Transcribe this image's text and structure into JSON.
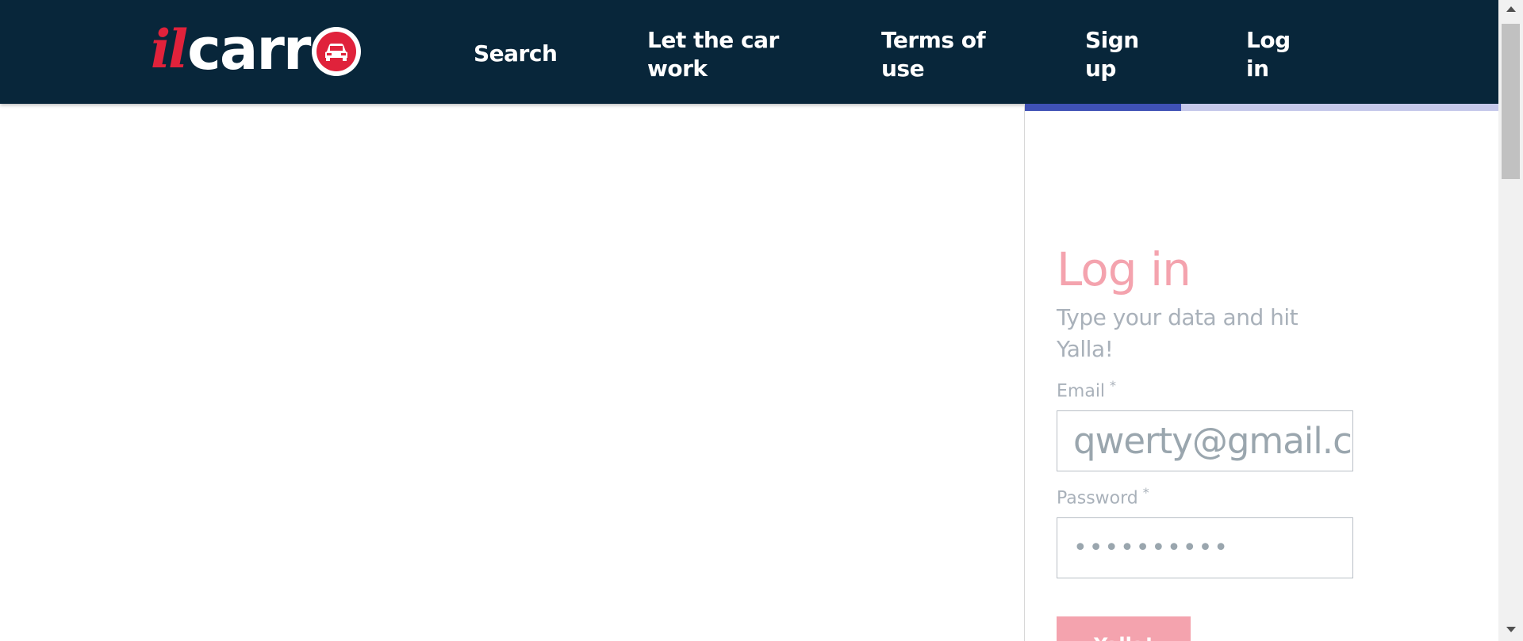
{
  "header": {
    "logo": {
      "il": "il",
      "carr": "carr",
      "icon": "car-icon"
    },
    "nav": {
      "search": "Search",
      "let_car_work": "Let the car work",
      "terms": "Terms of use",
      "signup": "Sign up",
      "login": "Log in"
    }
  },
  "login_form": {
    "title": "Log in",
    "subtitle": "Type your data and hit Yalla!",
    "email_label": "Email",
    "password_label": "Password",
    "required_marker": "*",
    "email_value": "qwerty@gmail.com",
    "password_value": "••••••••••",
    "submit_label": "Yalla!",
    "progress": 0.33
  },
  "colors": {
    "header_bg": "#08263a",
    "accent_red": "#e0223b",
    "title_pink": "#f4a3ae",
    "progress_fill": "#3f51b5",
    "progress_track": "#c5c8ea"
  }
}
